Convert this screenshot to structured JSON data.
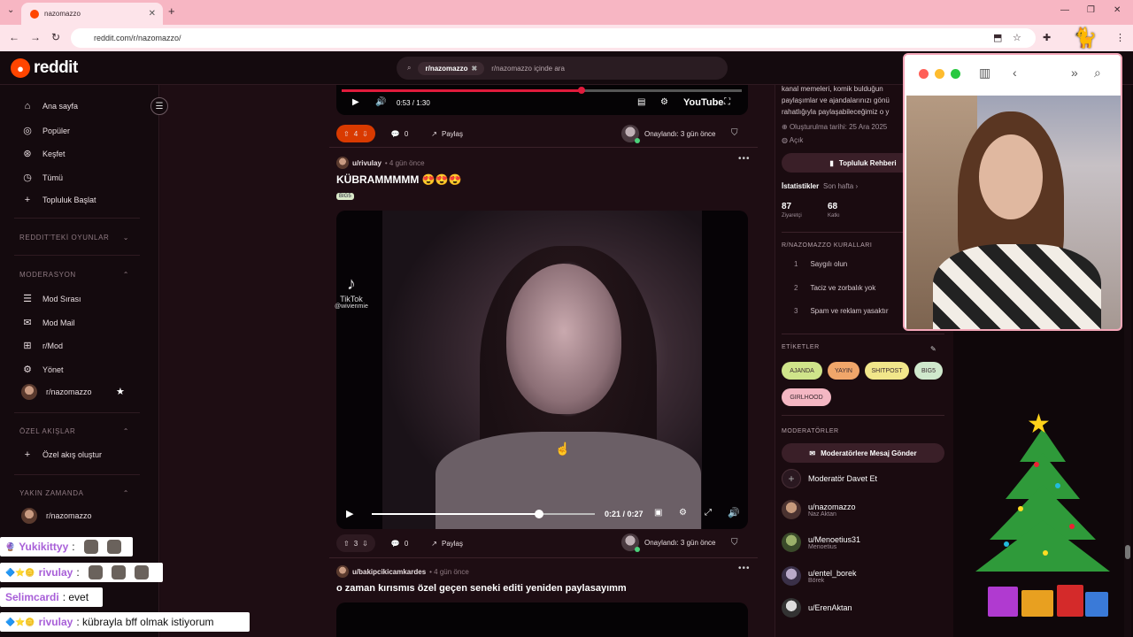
{
  "browser": {
    "tab_title": "nazomazzo",
    "url": "reddit.com/r/nazomazzo/"
  },
  "header": {
    "logo_text": "reddit",
    "search_chip": "r/nazomazzo",
    "search_placeholder": "r/nazomazzo içinde ara"
  },
  "sidebar": {
    "items": [
      {
        "icon": "home-icon",
        "label": "Ana sayfa"
      },
      {
        "icon": "popular-icon",
        "label": "Popüler"
      },
      {
        "icon": "explore-icon",
        "label": "Keşfet"
      },
      {
        "icon": "all-icon",
        "label": "Tümü"
      },
      {
        "icon": "plus-icon",
        "label": "Topluluk Başlat"
      }
    ],
    "games_section": "REDDIT'TEKİ OYUNLAR",
    "mod_section": "MODERASYON",
    "mod_items": [
      {
        "icon": "queue-icon",
        "label": "Mod Sırası"
      },
      {
        "icon": "mail-icon",
        "label": "Mod Mail"
      },
      {
        "icon": "mod-icon",
        "label": "r/Mod"
      },
      {
        "icon": "settings-icon",
        "label": "Yönet"
      },
      {
        "icon": "avatar",
        "label": "r/nazomazzo"
      }
    ],
    "custom_section": "ÖZEL AKIŞLAR",
    "custom_create": "Özel akış oluştur",
    "recent_section": "YAKIN ZAMANDA",
    "recent_item": "r/nazomazzo"
  },
  "feed": {
    "prev_post": {
      "video_time": "0:53 / 1:30",
      "video_progress": 0.6,
      "votes": "4",
      "comments": "0",
      "share": "Paylaş",
      "approved": "Onaylandı: 3 gün önce"
    },
    "post": {
      "author": "u/rivulay",
      "time": "• 4 gün önce",
      "title": "KÜBRAMMMMM 😍😍😍",
      "flair": "BIG5",
      "video_time": "0:21 / 0:27",
      "video_progress": 0.75,
      "watermark": "TikTok",
      "watermark_user": "@wivienmie",
      "votes": "3",
      "comments": "0",
      "share": "Paylaş",
      "approved": "Onaylandı: 3 gün önce"
    },
    "next_post": {
      "author": "u/bakipcikicamkardes",
      "time": "• 4 gün önce",
      "title": "o zaman kırısmıs özel geçen seneki editi yeniden paylasayımm"
    }
  },
  "right_sidebar": {
    "about_lines": [
      "kanal memeleri, komik bulduğun",
      "paylaşımlar ve ajandalarınızı gönü",
      "rahatlığıyla paylaşabileceğimiz o y"
    ],
    "created": "Oluşturulma tarihi: 25 Ara 2025",
    "visibility": "Açık",
    "guide_button": "Topluluk Rehberi",
    "stats_label": "İstatistikler",
    "stats_range": "Son hafta",
    "visitors": "87",
    "visitors_label": "Ziyaretçi",
    "contributions": "68",
    "contributions_label": "Katkı",
    "rules_title": "R/NAZOMAZZO KURALLARI",
    "rules": [
      {
        "n": "1",
        "text": "Saygılı olun"
      },
      {
        "n": "2",
        "text": "Taciz ve zorbalık yok"
      },
      {
        "n": "3",
        "text": "Spam ve reklam yasaktır"
      }
    ],
    "tags_title": "ETİKETLER",
    "tags": [
      {
        "label": "AJANDA",
        "color": "#cfe48a"
      },
      {
        "label": "YAYIN",
        "color": "#f0a66a"
      },
      {
        "label": "SHITPOST",
        "color": "#f1e68a"
      },
      {
        "label": "BIG5",
        "color": "#cfe8cc"
      },
      {
        "label": "GIRLHOOD",
        "color": "#f4b7c3"
      }
    ],
    "mods_title": "MODERATÖRLER",
    "message_mods": "Moderatörlere Mesaj Gönder",
    "invite_mod": "Moderatör Davet Et",
    "mods": [
      {
        "name": "u/nazomazzo",
        "sub": "Naz Aktan"
      },
      {
        "name": "u/Menoetius31",
        "sub": "Menoetius"
      },
      {
        "name": "u/entel_borek",
        "sub": "Börek"
      },
      {
        "name": "u/ErenAktan",
        "sub": ""
      }
    ]
  },
  "chat": [
    {
      "user": "Yukikittyy",
      "msg": ":",
      "emotes": 2
    },
    {
      "user": "rivulay",
      "msg": ":",
      "emotes": 3
    },
    {
      "user": "Selimcardi",
      "msg": ": evet",
      "emotes": 0
    },
    {
      "user": "rivulay",
      "msg": ": kübrayla bff olmak istiyorum",
      "emotes": 0
    }
  ]
}
